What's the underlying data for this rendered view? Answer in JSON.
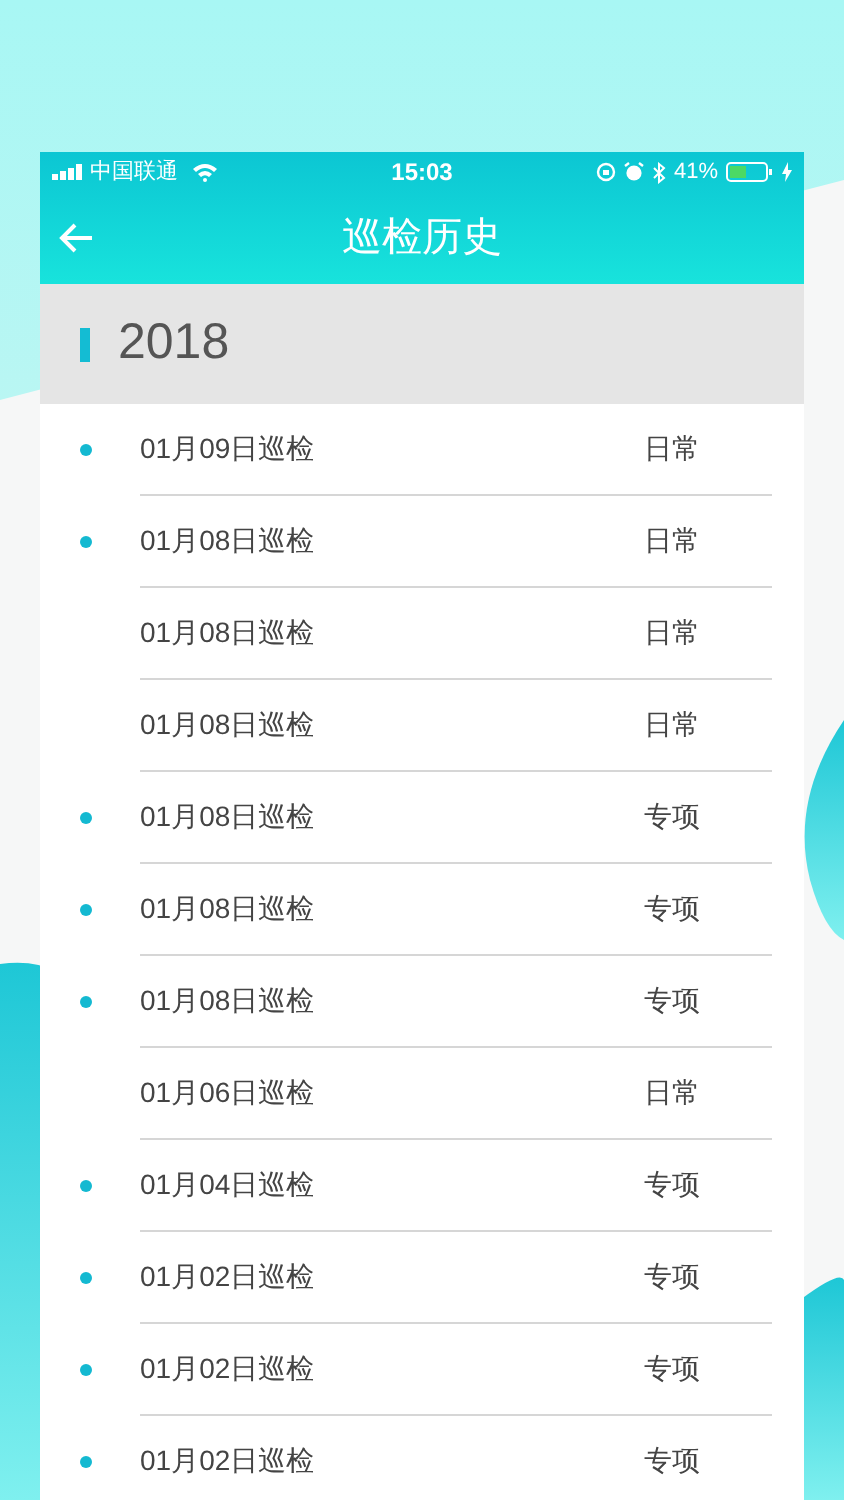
{
  "status_bar": {
    "carrier": "中国联通",
    "time": "15:03",
    "battery": "41%"
  },
  "header": {
    "title": "巡检历史"
  },
  "section": {
    "year": "2018"
  },
  "records": [
    {
      "date": "01月09日巡检",
      "type": "日常",
      "dot": true
    },
    {
      "date": "01月08日巡检",
      "type": "日常",
      "dot": true
    },
    {
      "date": "01月08日巡检",
      "type": "日常",
      "dot": false
    },
    {
      "date": "01月08日巡检",
      "type": "日常",
      "dot": false
    },
    {
      "date": "01月08日巡检",
      "type": "专项",
      "dot": true
    },
    {
      "date": "01月08日巡检",
      "type": "专项",
      "dot": true
    },
    {
      "date": "01月08日巡检",
      "type": "专项",
      "dot": true
    },
    {
      "date": "01月06日巡检",
      "type": "日常",
      "dot": false
    },
    {
      "date": "01月04日巡检",
      "type": "专项",
      "dot": true
    },
    {
      "date": "01月02日巡检",
      "type": "专项",
      "dot": true
    },
    {
      "date": "01月02日巡检",
      "type": "专项",
      "dot": true
    },
    {
      "date": "01月02日巡检",
      "type": "专项",
      "dot": true
    }
  ]
}
